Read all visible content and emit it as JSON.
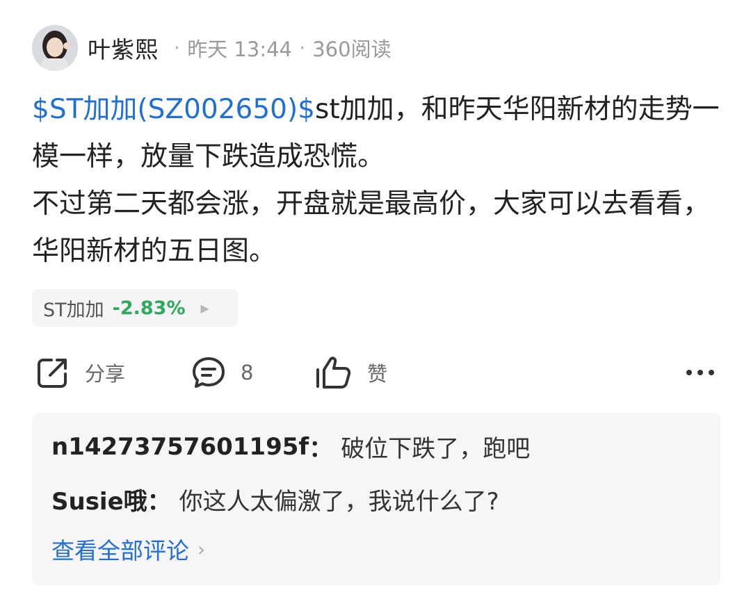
{
  "author": {
    "name": "叶紫熙",
    "time": "昨天 13:44",
    "reads": "360阅读",
    "separator": "·"
  },
  "post": {
    "stock_tag": "$ST加加(SZ002650)$",
    "text": "st加加，和昨天华阳新材的走势一模一样，放量下跌造成恐慌。\n不过第二天都会涨，开盘就是最高价，大家可以去看看，华阳新材的五日图。"
  },
  "stock_chip": {
    "name": "ST加加",
    "change": "-2.83%",
    "change_color": "#2eaa5c",
    "arrow": "▶"
  },
  "actions": {
    "share_label": "分享",
    "comment_count": "8",
    "like_label": "赞",
    "icons": [
      "share-icon",
      "comment-icon",
      "thumbs-up-icon",
      "more-icon"
    ]
  },
  "comments": {
    "items": [
      {
        "user": "n14273757601195f",
        "colon": "：",
        "text": "破位下跌了，跑吧"
      },
      {
        "user": "Susie哦",
        "colon": "：",
        "text": "你这人太偏激了，我说什么了?"
      }
    ],
    "view_all": "查看全部评论",
    "view_all_chevron": "›"
  },
  "colors": {
    "link": "#1f6fd6",
    "muted": "#9a9a9a",
    "comment_bg": "#f7f5f8"
  }
}
